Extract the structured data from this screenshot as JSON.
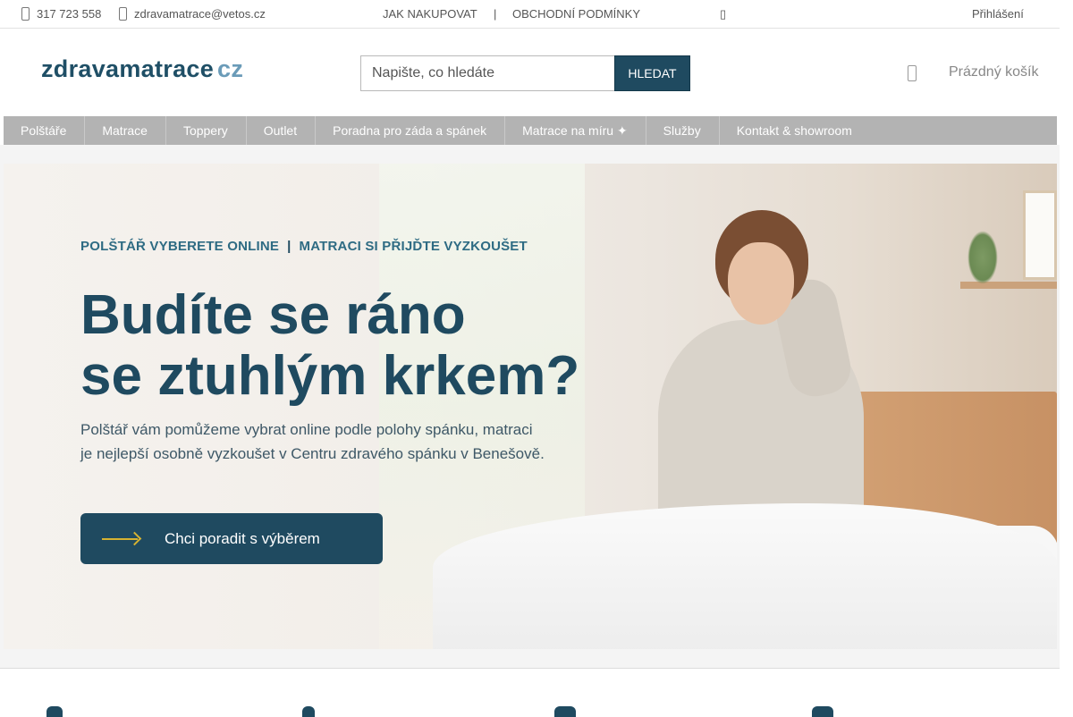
{
  "topbar": {
    "phone": "317 723 558",
    "email": "zdravamatrace@vetos.cz",
    "jak_nakupovat": "JAK NAKUPOVAT",
    "separator": "|",
    "obchodni_podminky": "OBCHODNÍ PODMÍNKY",
    "small_icon": "▯",
    "login": "Přihlášení"
  },
  "header": {
    "logo_main": "zdravamatrace",
    "logo_suffix": "cz",
    "search_placeholder": "Napište, co hledáte",
    "search_button": "HLEDAT",
    "cart_label": "Prázdný košík"
  },
  "nav": {
    "items": [
      "Polštáře",
      "Matrace",
      "Toppery",
      "Outlet",
      "Poradna pro záda a spánek",
      "Matrace na míru ✦",
      "Služby",
      "Kontakt & showroom"
    ]
  },
  "hero": {
    "tagline_left": "POLŠTÁŘ VYBERETE ONLINE",
    "tagline_sep": "|",
    "tagline_right": "MATRACI SI PŘIJĎTE VYZKOUŠET",
    "title_line1": "Budíte se ráno",
    "title_line2": "se ztuhlým krkem?",
    "subtitle_line1": "Polštář vám pomůžeme vybrat online podle polohy spánku, matraci",
    "subtitle_line2": "je nejlepší osobně vyzkoušet v Centru zdravého spánku v Benešově.",
    "cta_label": "Chci poradit s výběrem"
  },
  "colors": {
    "brand_dark": "#1f4a60",
    "brand_light": "#6a9bb8",
    "nav_bg": "#b3b3b3",
    "cta_arrow": "#d5b232"
  },
  "icons": {
    "phone": "phone-icon",
    "email": "email-icon",
    "cart": "cart-icon",
    "cta": "arrow-right-icon"
  }
}
